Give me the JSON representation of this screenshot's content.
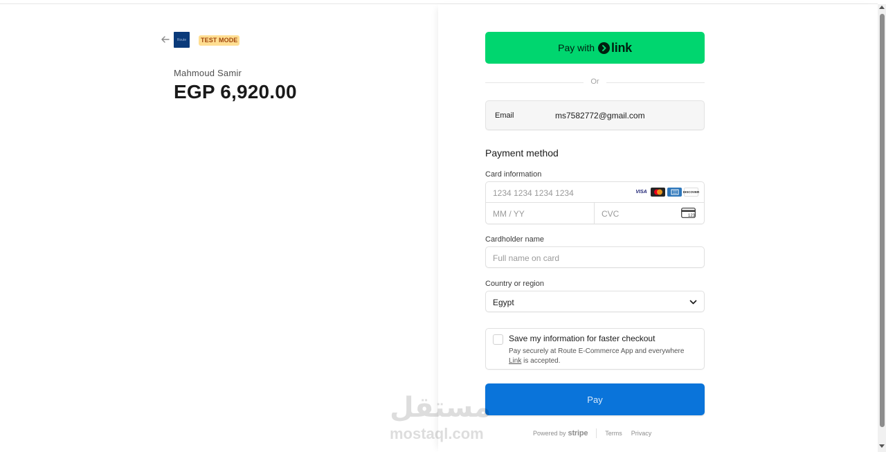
{
  "summary": {
    "logo_text": "Route",
    "test_badge": "TEST MODE",
    "merchant_name": "Mahmoud Samir",
    "amount": "EGP 6,920.00"
  },
  "link_button": {
    "prefix": "Pay with",
    "brand": "link"
  },
  "divider": {
    "label": "Or"
  },
  "email": {
    "label": "Email",
    "value": "ms7582772@gmail.com"
  },
  "payment": {
    "heading": "Payment method",
    "card_label": "Card information",
    "card_number_placeholder": "1234 1234 1234 1234",
    "expiry_placeholder": "MM / YY",
    "cvc_placeholder": "CVC",
    "cvc_icon_text": "123",
    "brands": [
      {
        "name": "VISA",
        "color": "#1a1f71"
      },
      {
        "name": "mastercard",
        "color": "#eb001b"
      },
      {
        "name": "AMEX",
        "color": "#2e77bb"
      },
      {
        "name": "DISCOVER",
        "color": "#f58220"
      }
    ],
    "cardholder_label": "Cardholder name",
    "cardholder_placeholder": "Full name on card",
    "country_label": "Country or region",
    "country_value": "Egypt"
  },
  "save_info": {
    "title": "Save my information for faster checkout",
    "desc_line1": "Pay securely at Route E-Commerce App and everywhere",
    "desc_link": "Link",
    "desc_line2": " is accepted."
  },
  "pay_button": {
    "label": "Pay"
  },
  "footer": {
    "powered_by": "Powered by",
    "brand": "stripe",
    "terms": "Terms",
    "privacy": "Privacy"
  },
  "watermark": {
    "arabic": "مستقل",
    "latin": "mostaql.com"
  },
  "colors": {
    "link_green": "#00d66f",
    "pay_blue": "#0a74da",
    "badge_bg": "#ffde92",
    "badge_text": "#a0460d"
  }
}
